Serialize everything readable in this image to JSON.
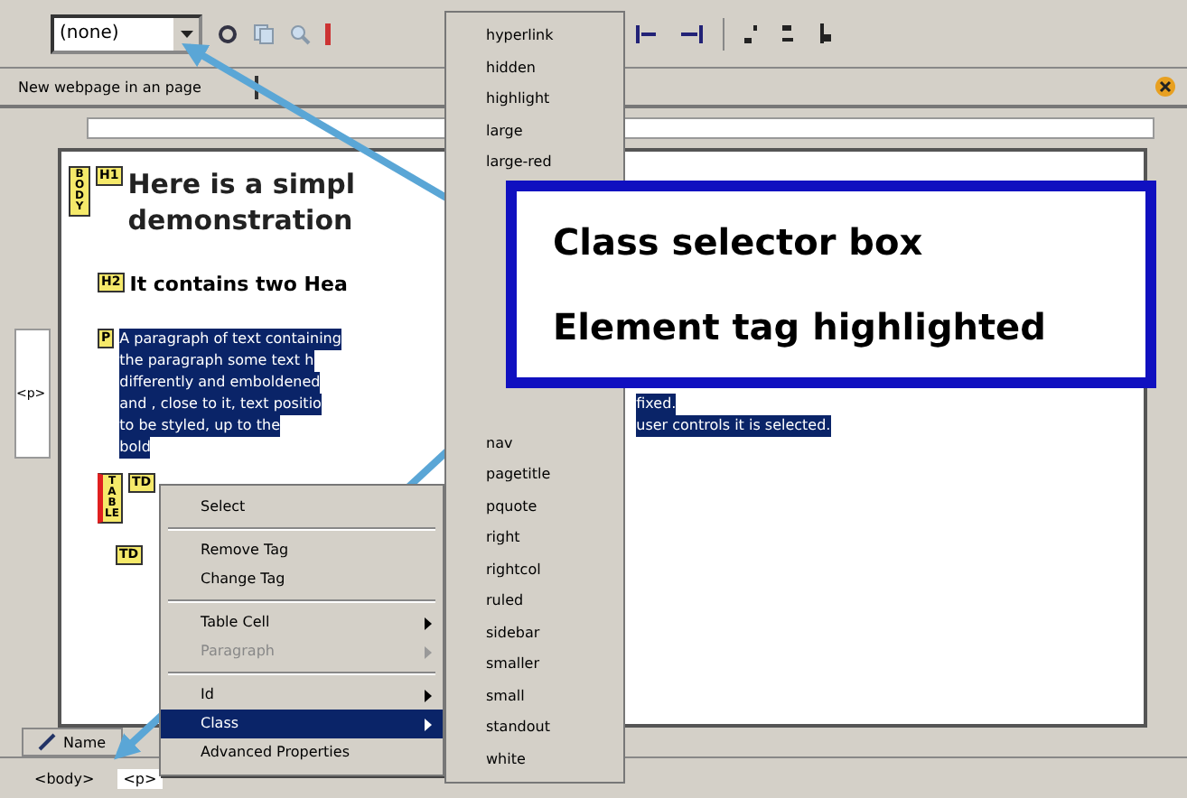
{
  "toolbar": {
    "class_selector": {
      "value": "(none)"
    }
  },
  "document_tab": {
    "label": "New webpage in an page"
  },
  "editor": {
    "tags": [
      {
        "kind": "block",
        "label": "BODY"
      },
      {
        "kind": "inline",
        "label": "H1"
      },
      {
        "kind": "inline",
        "label": "H2"
      },
      {
        "kind": "inline",
        "label": "P"
      },
      {
        "kind": "block",
        "label": "TABLE"
      },
      {
        "kind": "inline",
        "label": "TD"
      },
      {
        "kind": "inline",
        "label": "TD"
      }
    ],
    "heading_1": "Here is a simpl",
    "heading_1_line_2": "demonstration",
    "heading_2": "It contains two Hea",
    "paragraph_lines": [
      {
        "left": "A paragraph of text containing"
      },
      {
        "left": "the paragraph some text h"
      },
      {
        "left": "differently and emboldened"
      },
      {
        "left": "and , close to it, text positio",
        "right": "fixed."
      },
      {
        "left": "to be styled, up to the",
        "right": "user controls it is selected."
      },
      {
        "left": "bold"
      }
    ]
  },
  "left_panel": {
    "label": "<p>"
  },
  "bottom_tab": {
    "label": "Name"
  },
  "status_bar": {
    "tags": [
      {
        "label": "<body>",
        "selected": false
      },
      {
        "label": "<p>",
        "selected": true
      }
    ]
  },
  "context_menu": {
    "items": [
      {
        "kind": "item",
        "label": "Select",
        "disabled": false,
        "submenu": false,
        "selected": false
      },
      {
        "kind": "separator"
      },
      {
        "kind": "item",
        "label": "Remove Tag",
        "disabled": false,
        "submenu": false,
        "selected": false
      },
      {
        "kind": "item",
        "label": "Change Tag",
        "disabled": false,
        "submenu": false,
        "selected": false
      },
      {
        "kind": "separator"
      },
      {
        "kind": "item",
        "label": "Table Cell",
        "disabled": false,
        "submenu": true,
        "selected": false
      },
      {
        "kind": "item",
        "label": "Paragraph",
        "disabled": true,
        "submenu": true,
        "selected": false
      },
      {
        "kind": "separator"
      },
      {
        "kind": "item",
        "label": "Id",
        "disabled": false,
        "submenu": true,
        "selected": false
      },
      {
        "kind": "item",
        "label": "Class",
        "disabled": false,
        "submenu": true,
        "selected": true
      },
      {
        "kind": "item",
        "label": "Advanced Properties",
        "disabled": false,
        "submenu": false,
        "selected": false
      }
    ]
  },
  "class_submenu": {
    "top_items": [
      "hyperlink",
      "hidden",
      "highlight",
      "large",
      "large-red"
    ],
    "bottom_items": [
      "nav",
      "pagetitle",
      "pquote",
      "right",
      "rightcol",
      "ruled",
      "sidebar",
      "smaller",
      "small",
      "standout",
      "white"
    ]
  },
  "callout": {
    "lines": [
      "Class selector box",
      "Element tag highlighted"
    ]
  }
}
